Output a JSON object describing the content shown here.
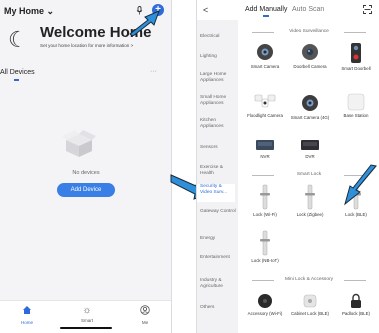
{
  "left": {
    "home_title": "My Home",
    "home_chevron": "⌄",
    "mic_icon": "mic-icon",
    "plus_label": "+",
    "welcome_title": "Welcome Home",
    "welcome_sub": "Set your home location for more information  >",
    "devices_label": "All Devices",
    "more_label": "···",
    "empty_text": "No devices",
    "add_device": "Add Device",
    "tabs": [
      {
        "label": "Home",
        "icon": "home-icon"
      },
      {
        "label": "Smart",
        "icon": "sun-icon"
      },
      {
        "label": "Me",
        "icon": "user-icon"
      }
    ]
  },
  "right": {
    "back": "<",
    "tab_manual": "Add Manually",
    "tab_scan": "Auto Scan",
    "categories": [
      "Electrical",
      "Lighting",
      "Large Home Appliances",
      "Small Home Appliances",
      "Kitchen Appliances",
      "Sensors",
      "Exercise & Health",
      "Security & Video Surv...",
      "Gateway Control",
      "Energy",
      "Entertainment",
      "Industry & Agriculture",
      "Others"
    ],
    "sections": {
      "video": "Video Surveillance",
      "lock": "Smart Lock",
      "mini": "Mini Lock & Accessory"
    },
    "video_devices": [
      "Smart Camera",
      "Doorbell Camera",
      "Smart Doorbell",
      "Floodlight Camera",
      "Smart Camera (4G)",
      "Base Station",
      "NVR",
      "DVR"
    ],
    "lock_devices": [
      "Lock (Wi-Fi)",
      "Lock (Zigbee)",
      "Lock (BLE)",
      "Lock (NB-IoT)"
    ],
    "mini_devices": [
      "Accessory (Wi-Fi)",
      "Cabinet Lock (BLE)",
      "Padlock (BLE)"
    ]
  },
  "colors": {
    "accent": "#2e6bd8",
    "button": "#3a7fe6",
    "arrow": "#2f8fd8"
  }
}
